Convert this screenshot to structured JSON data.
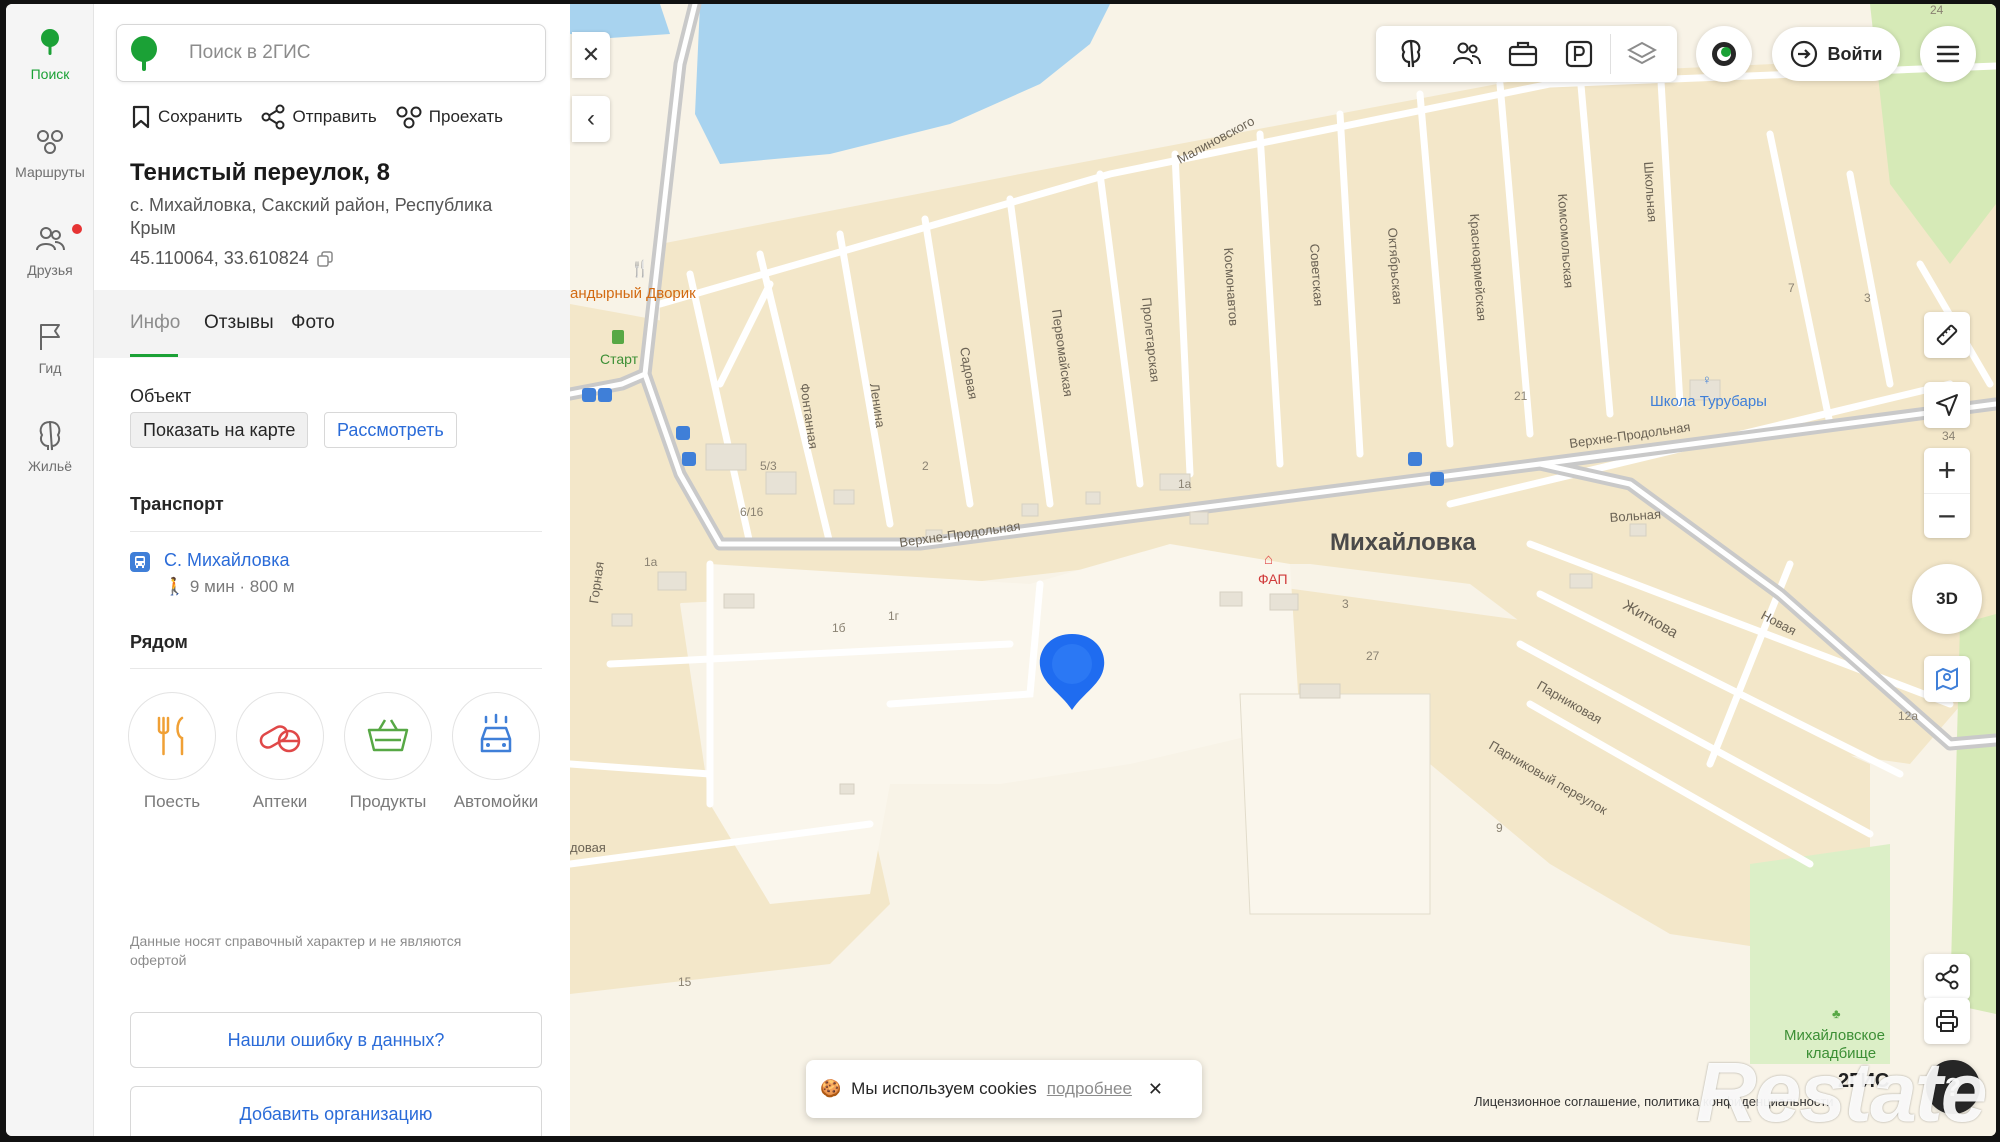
{
  "sidebar": {
    "items": [
      {
        "label": "Поиск",
        "icon": "tree-pin-icon"
      },
      {
        "label": "Маршруты",
        "icon": "routes-icon"
      },
      {
        "label": "Друзья",
        "icon": "friends-icon"
      },
      {
        "label": "Гид",
        "icon": "flag-icon"
      },
      {
        "label": "Жильё",
        "icon": "housing-icon"
      }
    ]
  },
  "search": {
    "placeholder": "Поиск в 2ГИС",
    "value": ""
  },
  "actions": {
    "save": "Сохранить",
    "share": "Отправить",
    "route": "Проехать"
  },
  "place": {
    "title": "Тенистый переулок, 8",
    "address": "с. Михайловка, Сакский район, Республика Крым",
    "coords": "45.110064, 33.610824"
  },
  "tabs": [
    {
      "label": "Инфо",
      "active": true
    },
    {
      "label": "Отзывы",
      "active": false
    },
    {
      "label": "Фото",
      "active": false
    }
  ],
  "object": {
    "heading": "Объект",
    "show_on_map": "Показать на карте",
    "view": "Рассмотреть"
  },
  "transport": {
    "heading": "Транспорт",
    "stop_name": "С. Михайловка",
    "walk": "9 мин · 800 м"
  },
  "nearby": {
    "heading": "Рядом",
    "items": [
      {
        "label": "Поесть",
        "icon": "fork-knife-icon",
        "color": "#f0a035"
      },
      {
        "label": "Аптеки",
        "icon": "pills-icon",
        "color": "#e04848"
      },
      {
        "label": "Продукты",
        "icon": "basket-icon",
        "color": "#57a845"
      },
      {
        "label": "Автомойки",
        "icon": "carwash-icon",
        "color": "#3f7fd8"
      }
    ]
  },
  "disclaimer": "Данные носят справочный характер и не являются офертой",
  "report_error": "Нашли ошибку в данных?",
  "add_org": "Добавить организацию",
  "map": {
    "login": "Войти",
    "btn3d": "3D",
    "cookie_text": "Мы используем cookies",
    "cookie_more": "подробнее",
    "license": "Лицензионное соглашение, политика конфиденциальности",
    "brand": "2ГИС",
    "watermark": "Restate",
    "village": "Михайловка",
    "poi": {
      "cafe": "андырный Дворик",
      "start": "Старт",
      "fap": "ФАП",
      "school": "Школа Турубары",
      "cemetery_1": "Михайловское",
      "cemetery_2": "кладбище"
    },
    "streets": {
      "malinovskogo": "Малиновского",
      "fontannaya": "Фонтанная",
      "lenina": "Ленина",
      "sadovaya": "Садовая",
      "pervomayskaya": "Первомайская",
      "proletarskaya": "Пролетарская",
      "kosmonavtov": "Космонавтов",
      "sovetskaya": "Советская",
      "oktyabrskaya": "Октябрьская",
      "krasnoarmeyskaya": "Красноармейская",
      "komsomolskaya": "Комсомольская",
      "shkolnaya": "Школьная",
      "verkhne_1": "Верхне-Продольная",
      "verkhne_2": "Верхне-Продольная",
      "volnaya": "Вольная",
      "zhitkova": "Житкова",
      "novaya": "Новая",
      "parnikovaya": "Парниковая",
      "parnikovy": "Парниковый переулок",
      "gornaya": "Горная",
      "dovaya": "довая"
    },
    "house_numbers": [
      "5/3",
      "6/16",
      "2",
      "1а",
      "1а",
      "1б",
      "1г",
      "3",
      "27",
      "21",
      "9",
      "15",
      "7",
      "3",
      "24",
      "34",
      "12а"
    ]
  },
  "colors": {
    "accent_green": "#1ba136",
    "link_blue": "#2a6bd8",
    "pin_blue": "#1f6cf0",
    "water": "#a8d3ef",
    "land": "#f6ecd3",
    "road": "#cfcfcf"
  }
}
